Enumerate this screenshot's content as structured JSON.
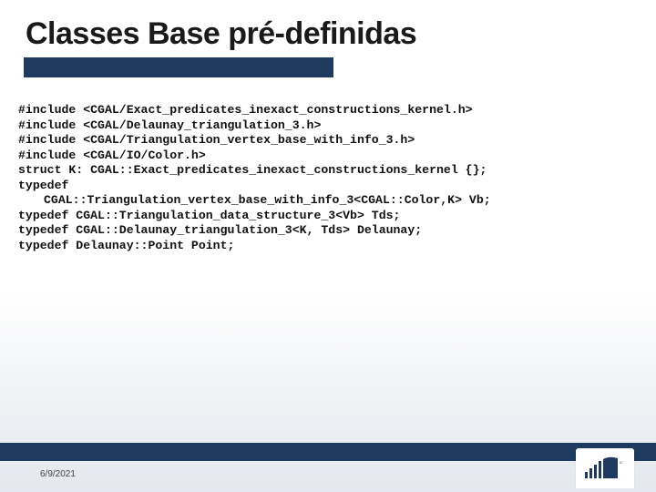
{
  "title": "Classes Base pré-definidas",
  "code": {
    "l1": "#include <CGAL/Exact_predicates_inexact_constructions_kernel.h>",
    "l2": "#include <CGAL/Delaunay_triangulation_3.h>",
    "l3": "#include <CGAL/Triangulation_vertex_base_with_info_3.h>",
    "l4": "#include <CGAL/IO/Color.h>",
    "l5": "struct K: CGAL::Exact_predicates_inexact_constructions_kernel {};",
    "l6": "typedef",
    "l6b": "CGAL::Triangulation_vertex_base_with_info_3<CGAL::Color,K> Vb;",
    "l7": "typedef CGAL::Triangulation_data_structure_3<Vb> Tds;",
    "l8": "typedef CGAL::Delaunay_triangulation_3<K, Tds> Delaunay;",
    "l9": "typedef Delaunay::Point Point;"
  },
  "footer": {
    "date": "6/9/2021"
  }
}
